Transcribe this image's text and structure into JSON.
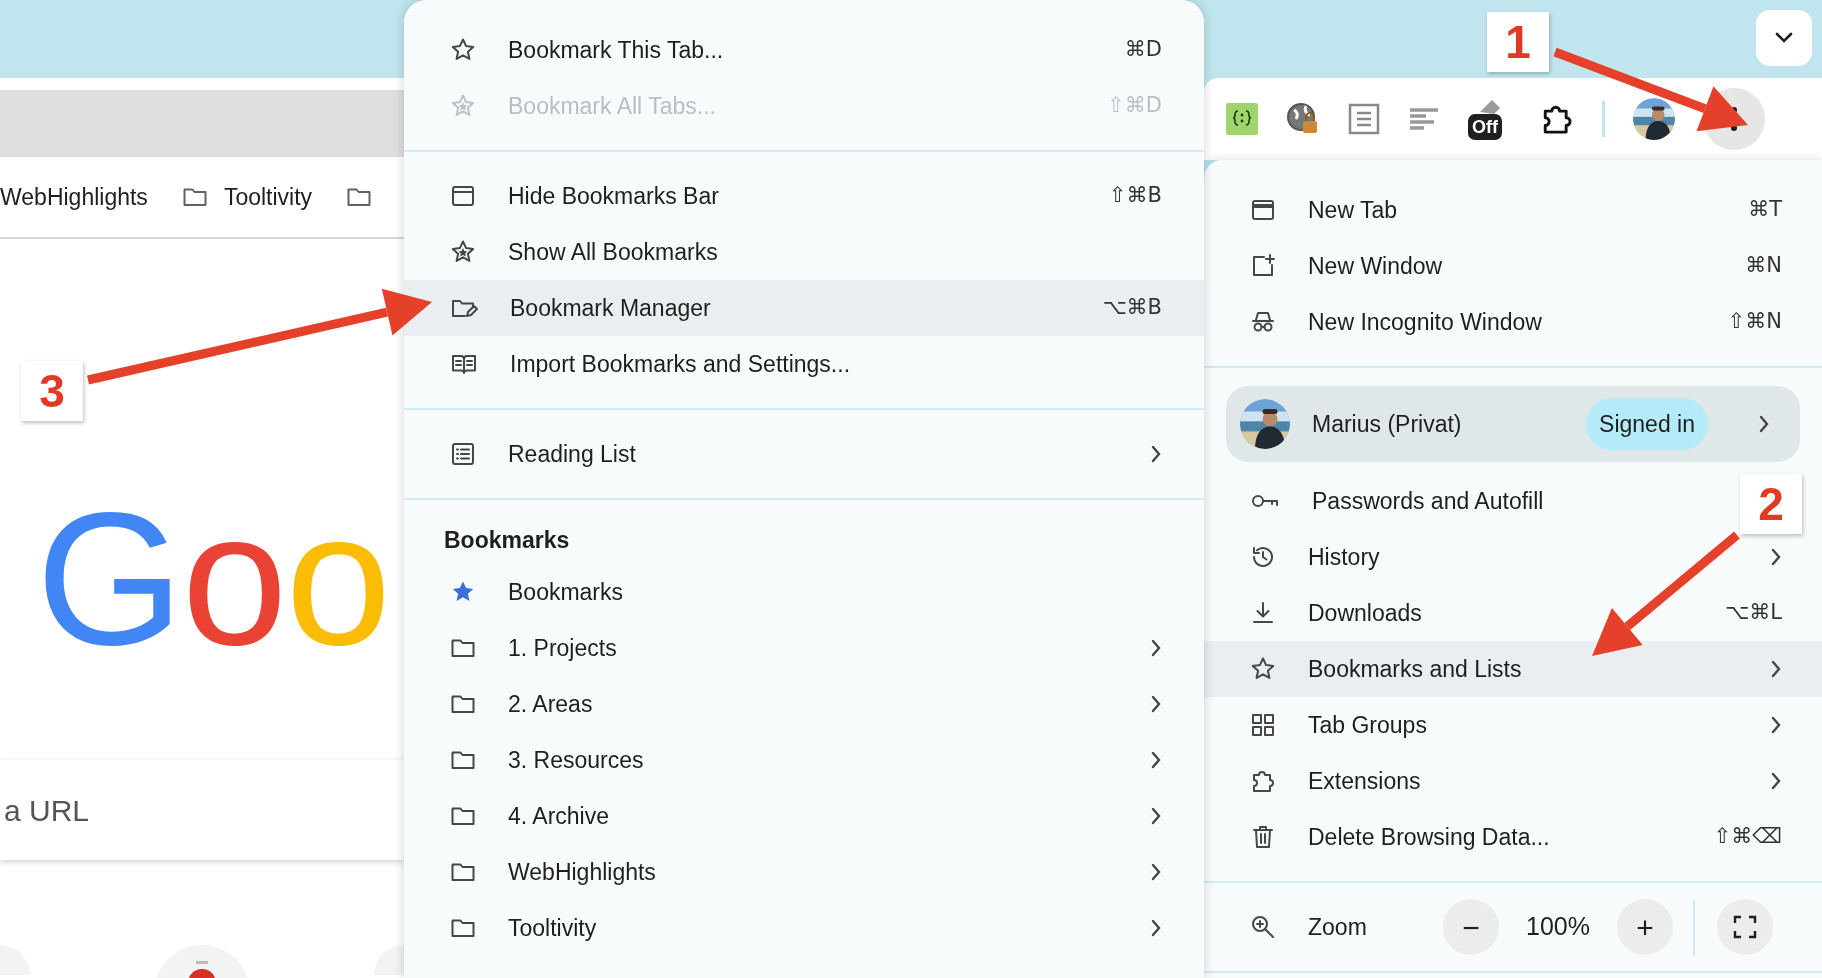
{
  "bookmarks_bar": [
    {
      "kind": "text",
      "label": "WebHighlights"
    },
    {
      "kind": "folder",
      "label": "Tooltivity"
    },
    {
      "kind": "folder"
    }
  ],
  "new_tab_page": {
    "logo": "Goo",
    "search_text": "a URL"
  },
  "toolbar": {
    "badge": "Off"
  },
  "bookmarks_menu": {
    "sections": [
      {
        "items": [
          {
            "label": "Bookmark This Tab...",
            "shortcut": "⌘D",
            "submenu": false,
            "highlighted": false,
            "disabled": false
          },
          {
            "label": "Bookmark All Tabs...",
            "shortcut": "⇧⌘D",
            "submenu": false,
            "highlighted": false,
            "disabled": true
          }
        ]
      },
      {
        "items": [
          {
            "label": "Hide Bookmarks Bar",
            "shortcut": "⇧⌘B",
            "submenu": false,
            "highlighted": false,
            "disabled": false
          },
          {
            "label": "Show All Bookmarks",
            "submenu": false,
            "highlighted": false,
            "disabled": false
          },
          {
            "label": "Bookmark Manager",
            "shortcut": "⌥⌘B",
            "submenu": false,
            "highlighted": true,
            "disabled": false
          },
          {
            "label": "Import Bookmarks and Settings...",
            "submenu": false,
            "highlighted": false,
            "disabled": false
          }
        ]
      },
      {
        "items": [
          {
            "label": "Reading List",
            "submenu": true,
            "highlighted": false,
            "disabled": false
          }
        ]
      },
      {
        "heading": "Bookmarks",
        "items": [
          {
            "label": "Bookmarks",
            "submenu": false,
            "highlighted": false,
            "disabled": false
          },
          {
            "label": "1. Projects",
            "submenu": true,
            "highlighted": false,
            "disabled": false
          },
          {
            "label": "2. Areas",
            "submenu": true,
            "highlighted": false,
            "disabled": false
          },
          {
            "label": "3. Resources",
            "submenu": true,
            "highlighted": false,
            "disabled": false
          },
          {
            "label": "4. Archive",
            "submenu": true,
            "highlighted": false,
            "disabled": false
          },
          {
            "label": "WebHighlights",
            "submenu": true,
            "highlighted": false,
            "disabled": false
          },
          {
            "label": "Tooltivity",
            "submenu": true,
            "highlighted": false,
            "disabled": false
          }
        ]
      }
    ]
  },
  "main_menu": {
    "top_items": [
      {
        "label": "New Tab",
        "shortcut": "⌘T",
        "submenu": false,
        "highlighted": false
      },
      {
        "label": "New Window",
        "shortcut": "⌘N",
        "submenu": false,
        "highlighted": false
      },
      {
        "label": "New Incognito Window",
        "shortcut": "⇧⌘N",
        "submenu": false,
        "highlighted": false
      }
    ],
    "profile": {
      "name": "Marius (Privat)",
      "badge": "Signed in"
    },
    "items": [
      {
        "label": "Passwords and Autofill",
        "submenu": false,
        "highlighted": false
      },
      {
        "label": "History",
        "submenu": true,
        "highlighted": false
      },
      {
        "label": "Downloads",
        "shortcut": "⌥⌘L",
        "submenu": false,
        "highlighted": false
      },
      {
        "label": "Bookmarks and Lists",
        "submenu": true,
        "highlighted": true
      },
      {
        "label": "Tab Groups",
        "submenu": true,
        "highlighted": false
      },
      {
        "label": "Extensions",
        "submenu": true,
        "highlighted": false
      },
      {
        "label": "Delete Browsing Data...",
        "shortcut": "⇧⌘⌫",
        "submenu": false,
        "highlighted": false
      }
    ],
    "zoom": {
      "label": "Zoom",
      "minus": "−",
      "value": "100%",
      "plus": "+"
    }
  },
  "annotations": [
    {
      "number": "1"
    },
    {
      "number": "2"
    },
    {
      "number": "3"
    }
  ]
}
